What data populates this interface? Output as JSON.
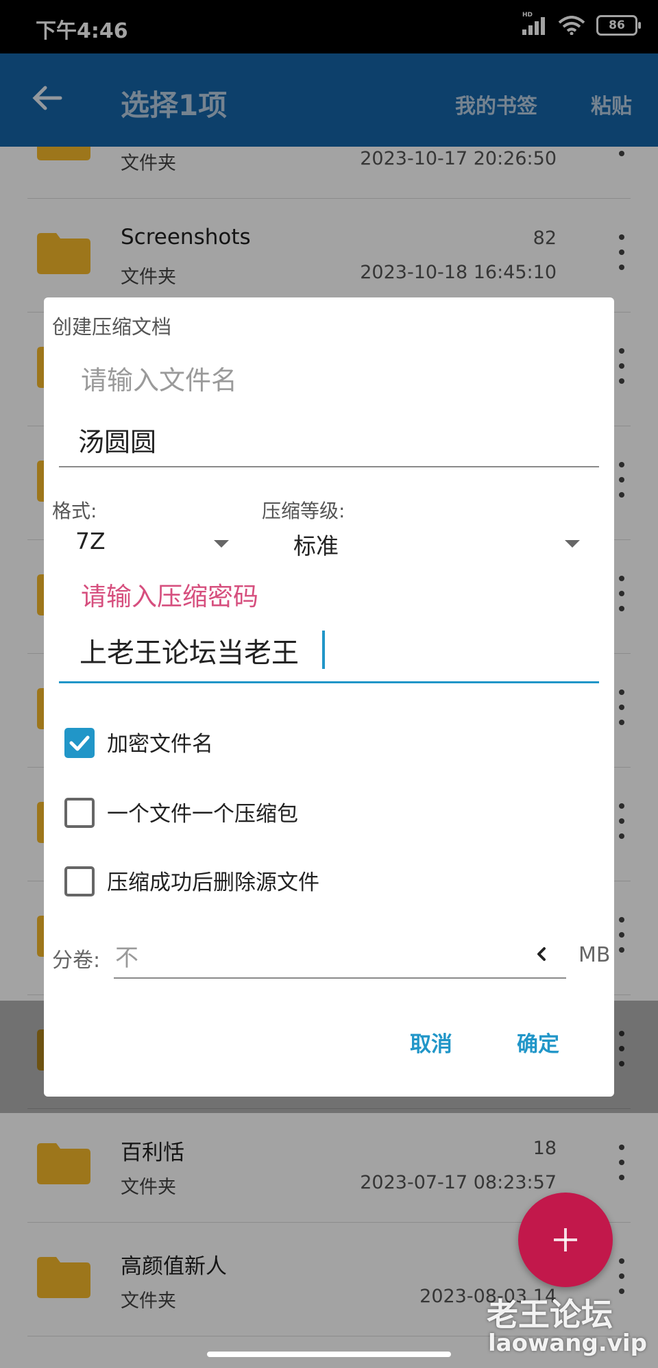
{
  "status_bar": {
    "time": "下午4:46",
    "network_label": "HD",
    "battery": "86"
  },
  "app_bar": {
    "title": "选择1项",
    "action_bookmarks": "我的书签",
    "action_paste": "粘贴"
  },
  "file_list": {
    "rows": [
      {
        "name": "",
        "count": "",
        "type": "文件夹",
        "date": "2023-10-17 20:26:50"
      },
      {
        "name": "Screenshots",
        "count": "82",
        "type": "文件夹",
        "date": "2023-10-18 16:45:10"
      },
      {
        "name": "",
        "count": "",
        "type": "",
        "date": ""
      },
      {
        "name": "",
        "count": "",
        "type": "",
        "date": ""
      },
      {
        "name": "",
        "count": "",
        "type": "",
        "date": ""
      },
      {
        "name": "",
        "count": "",
        "type": "",
        "date": ""
      },
      {
        "name": "",
        "count": "",
        "type": "",
        "date": ""
      },
      {
        "name": "",
        "count": "",
        "type": "",
        "date": ""
      },
      {
        "name": "",
        "count": "",
        "type": "",
        "date": ""
      },
      {
        "name": "百利恬",
        "count": "18",
        "type": "文件夹",
        "date": "2023-07-17 08:23:57"
      },
      {
        "name": "高颜值新人",
        "count": "",
        "type": "文件夹",
        "date": "2023-08-03 14"
      }
    ]
  },
  "dialog": {
    "title": "创建压缩文档",
    "filename_placeholder": "请输入文件名",
    "filename_value": "汤圆圆",
    "format_label": "格式:",
    "format_value": "7Z",
    "level_label": "压缩等级:",
    "level_value": "标准",
    "password_placeholder": "请输入压缩密码",
    "password_value": "上老王论坛当老王",
    "options": [
      {
        "label": "加密文件名",
        "checked": true
      },
      {
        "label": "一个文件一个压缩包",
        "checked": false
      },
      {
        "label": "压缩成功后删除源文件",
        "checked": false
      }
    ],
    "split_label": "分卷:",
    "split_placeholder": "不",
    "split_unit": "MB",
    "cancel_label": "取消",
    "ok_label": "确定"
  },
  "watermark": {
    "line1": "老王论坛",
    "line2": "laowang.vip"
  },
  "colors": {
    "app_bar": "#1565a8",
    "accent": "#2196c8",
    "password_hint": "#d64f7e",
    "fab": "#c2184b",
    "folder": "#f6b92b"
  }
}
